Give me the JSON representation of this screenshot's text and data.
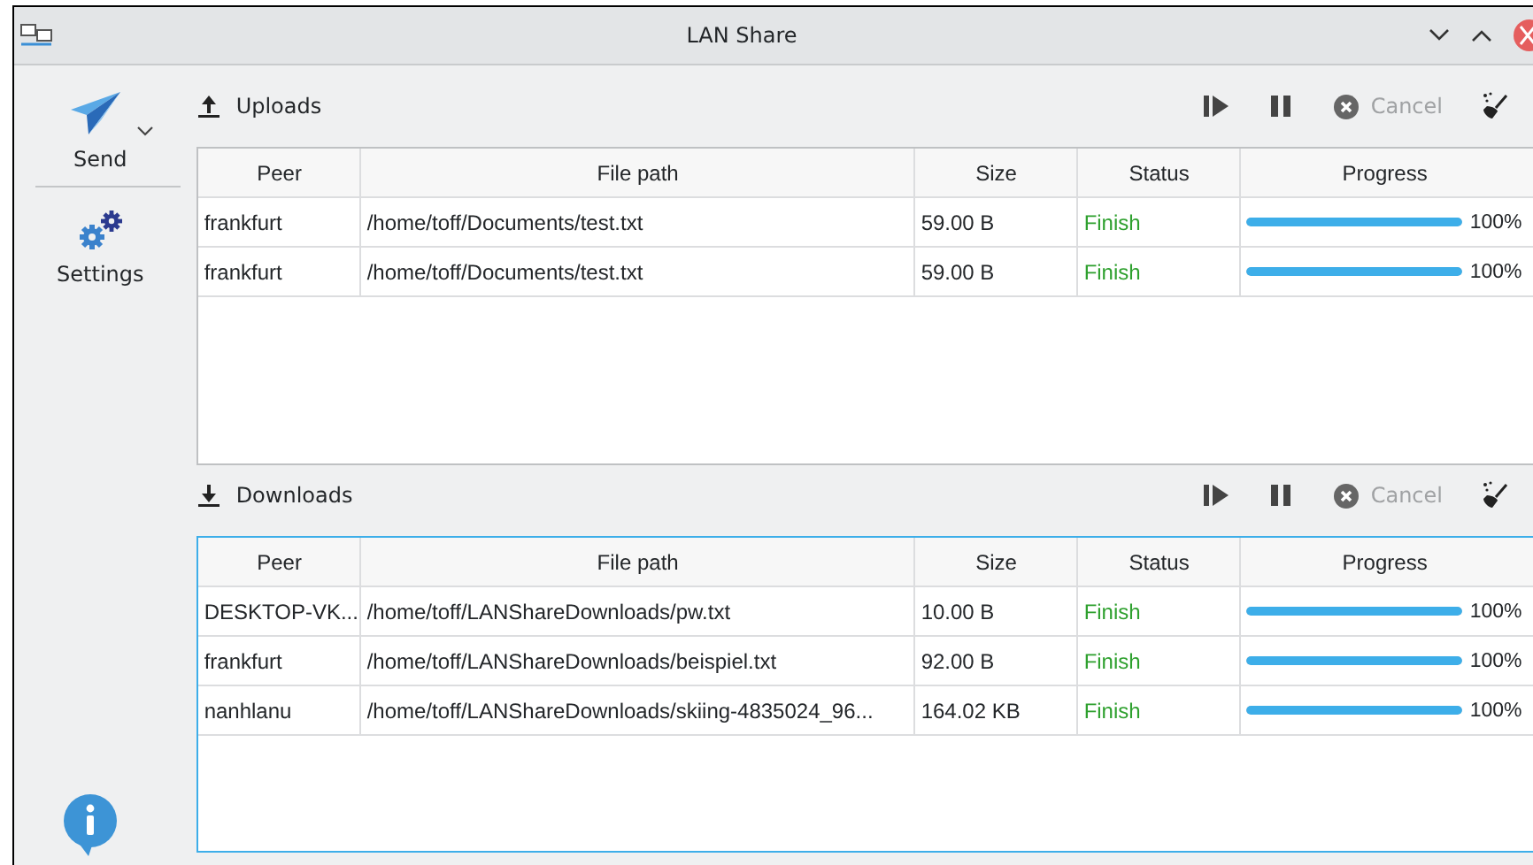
{
  "window": {
    "title": "LAN Share"
  },
  "sidebar": {
    "items": [
      {
        "label": "Send",
        "kind": "send",
        "selected": false
      },
      {
        "label": "Settings",
        "kind": "settings",
        "selected": false
      }
    ]
  },
  "sections": [
    {
      "kind": "upload",
      "title": "Uploads",
      "focused": false,
      "cancel": {
        "label": "Cancel",
        "disabled": true
      },
      "columns": [
        "Peer",
        "File path",
        "Size",
        "Status",
        "Progress"
      ],
      "rows": [
        {
          "peer": "frankfurt",
          "path": "/home/toff/Documents/test.txt",
          "size": "59.00 B",
          "status": "Finish",
          "level": 1,
          "percent": "100%"
        },
        {
          "peer": "frankfurt",
          "path": "/home/toff/Documents/test.txt",
          "size": "59.00 B",
          "status": "Finish",
          "level": 1,
          "percent": "100%"
        }
      ]
    },
    {
      "kind": "download",
      "title": "Downloads",
      "focused": true,
      "cancel": {
        "label": "Cancel",
        "disabled": true
      },
      "columns": [
        "Peer",
        "File path",
        "Size",
        "Status",
        "Progress"
      ],
      "rows": [
        {
          "peer": "DESKTOP-VK...",
          "path": "/home/toff/LANShareDownloads/pw.txt",
          "size": "10.00 B",
          "status": "Finish",
          "level": 1,
          "percent": "100%"
        },
        {
          "peer": "frankfurt",
          "path": "/home/toff/LANShareDownloads/beispiel.txt",
          "size": "92.00 B",
          "status": "Finish",
          "level": 1,
          "percent": "100%"
        },
        {
          "peer": "nanhlanu",
          "path": "/home/toff/LANShareDownloads/skiing-4835024_96...",
          "size": "164.02 KB",
          "status": "Finish",
          "level": 1,
          "percent": "100%"
        }
      ]
    }
  ]
}
